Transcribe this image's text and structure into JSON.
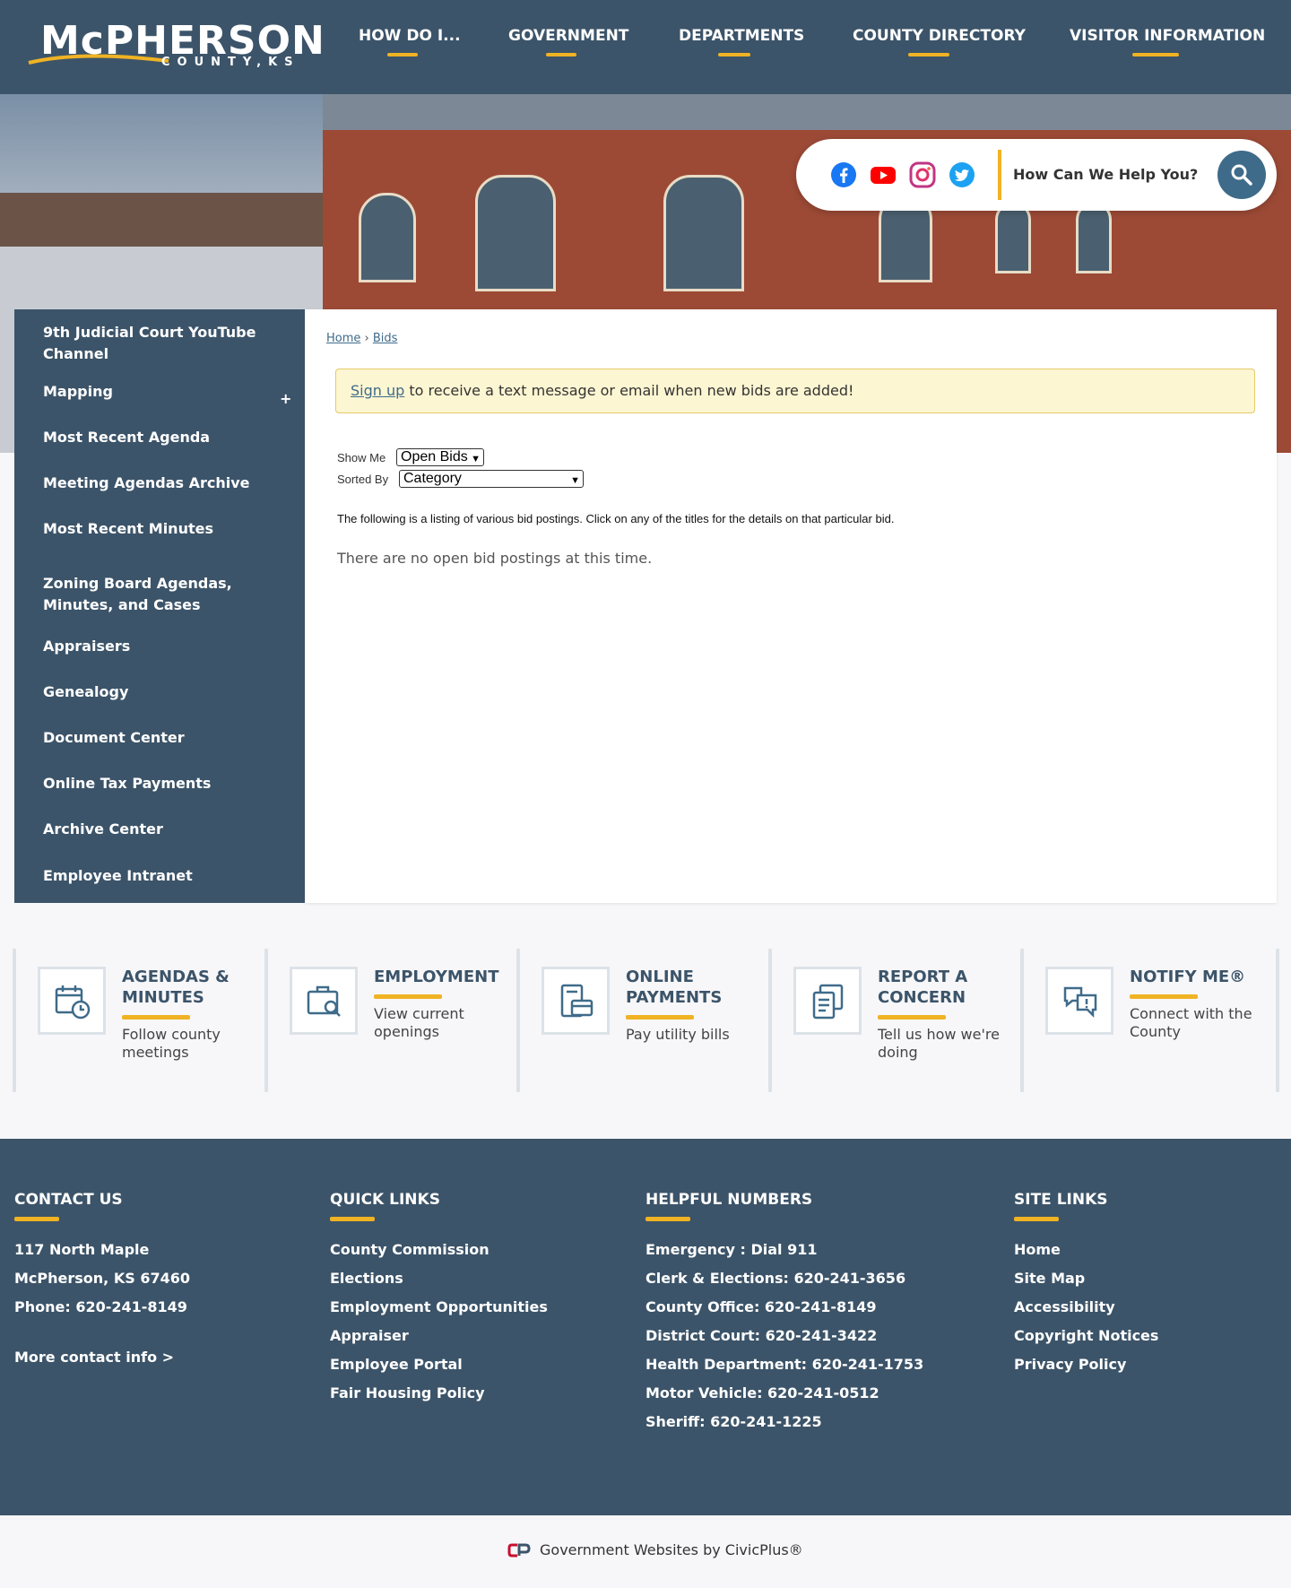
{
  "header": {
    "logo_main": "McPHERSON",
    "logo_sub": "COUNTY,KS",
    "nav": [
      {
        "label": "HOW DO I..."
      },
      {
        "label": "GOVERNMENT"
      },
      {
        "label": "DEPARTMENTS"
      },
      {
        "label": "COUNTY DIRECTORY"
      },
      {
        "label": "VISITOR INFORMATION"
      }
    ]
  },
  "search": {
    "placeholder": "How Can We Help You?",
    "social": [
      "facebook-icon",
      "youtube-icon",
      "instagram-icon",
      "twitter-icon"
    ]
  },
  "sidebar": {
    "items": [
      {
        "label": "9th Judicial Court YouTube Channel"
      },
      {
        "label": "Mapping"
      },
      {
        "label": "Most Recent Agenda"
      },
      {
        "label": "Meeting Agendas Archive"
      },
      {
        "label": "Most Recent Minutes"
      },
      {
        "label": "Zoning Board Agendas, Minutes, and Cases"
      },
      {
        "label": "Appraisers"
      },
      {
        "label": "Genealogy"
      },
      {
        "label": "Document Center"
      },
      {
        "label": "Online Tax Payments"
      },
      {
        "label": "Archive Center"
      },
      {
        "label": "Employee Intranet"
      }
    ],
    "expand_symbol": "+"
  },
  "main": {
    "breadcrumb": {
      "home": "Home",
      "sep": "›",
      "current": "Bids"
    },
    "alert": {
      "link": "Sign up",
      "text": " to receive a text message or email when new bids are added!"
    },
    "show_me_label": "Show Me",
    "show_me_value": "Open Bids",
    "sorted_by_label": "Sorted By",
    "sorted_by_value": "Category",
    "listing_text": "The following is a listing of various bid postings. Click on any of the titles for the details on that particular bid.",
    "empty_text": "There are no open bid postings at this time."
  },
  "tiles": [
    {
      "title": "AGENDAS & MINUTES",
      "desc": "Follow county meetings",
      "icon": "calendar-clock-icon"
    },
    {
      "title": "EMPLOYMENT",
      "desc": "View current openings",
      "icon": "briefcase-search-icon"
    },
    {
      "title": "ONLINE PAYMENTS",
      "desc": "Pay utility bills",
      "icon": "payment-terminal-icon"
    },
    {
      "title": "REPORT A CONCERN",
      "desc": "Tell us how we're doing",
      "icon": "report-document-icon"
    },
    {
      "title": "NOTIFY ME®",
      "desc": "Connect with the County",
      "icon": "notify-chat-icon"
    }
  ],
  "footer": {
    "contact": {
      "heading": "CONTACT US",
      "lines": [
        "117 North Maple",
        "McPherson, KS 67460",
        "Phone: 620-241-8149"
      ],
      "more": "More contact info >"
    },
    "quick_links": {
      "heading": "QUICK LINKS",
      "items": [
        "County Commission",
        "Elections",
        "Employment Opportunities",
        "Appraiser",
        "Employee Portal",
        "Fair Housing Policy"
      ]
    },
    "helpful_numbers": {
      "heading": "HELPFUL NUMBERS",
      "items": [
        "Emergency : Dial 911",
        "Clerk & Elections: 620-241-3656",
        "County Office: 620-241-8149",
        "District Court: 620-241-3422",
        "Health Department: 620-241-1753",
        "Motor Vehicle: 620-241-0512",
        "Sheriff: 620-241-1225"
      ]
    },
    "site_links": {
      "heading": "SITE LINKS",
      "items": [
        "Home",
        "Site Map",
        "Accessibility",
        "Copyright Notices",
        "Privacy Policy"
      ]
    }
  },
  "bottom": {
    "credit": "Government Websites by CivicPlus®"
  },
  "colors": {
    "brand_blue": "#3c5469",
    "accent_gold": "#f0b323",
    "link_blue": "#3f6b8a",
    "alert_bg": "#fdf6d2"
  }
}
